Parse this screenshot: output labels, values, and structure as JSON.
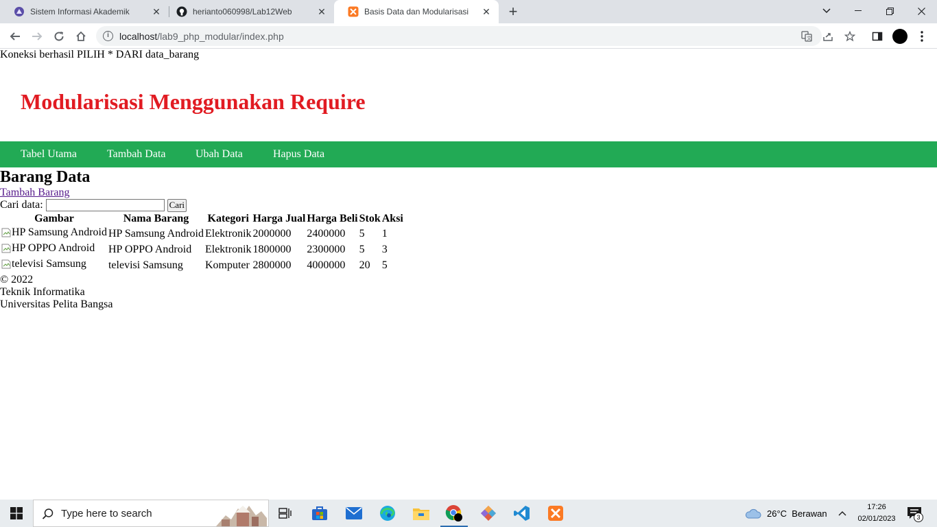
{
  "browser": {
    "tabs": [
      {
        "title": "Sistem Informasi Akademik",
        "icon": "university-icon",
        "active": false
      },
      {
        "title": "herianto060998/Lab12Web",
        "icon": "github-icon",
        "active": false
      },
      {
        "title": "Basis Data dan Modularisasi",
        "icon": "xampp-icon",
        "active": true
      }
    ],
    "url_host": "localhost",
    "url_path": "/lab9_php_modular/index.php"
  },
  "page": {
    "connection_message": "Koneksi berhasil PILIH * DARI data_barang",
    "site_title": "Modularisasi Menggunakan Require",
    "nav": [
      "Tabel Utama",
      "Tambah Data",
      "Ubah Data",
      "Hapus Data"
    ],
    "heading": "Barang Data",
    "add_link": "Tambah Barang",
    "search_label": "Cari data:",
    "search_value": "",
    "search_button": "Cari",
    "table": {
      "headers": [
        "Gambar",
        "Nama Barang",
        "Kategori",
        "Harga Jual",
        "Harga Beli",
        "Stok",
        "Aksi"
      ],
      "rows": [
        [
          "HP Samsung Android",
          "HP Samsung Android",
          "Elektronik",
          "2000000",
          "2400000",
          "5",
          "1"
        ],
        [
          "HP OPPO Android",
          "HP OPPO Android",
          "Elektronik",
          "1800000",
          "2300000",
          "5",
          "3"
        ],
        [
          "televisi Samsung",
          "televisi Samsung",
          "Komputer",
          "2800000",
          "4000000",
          "20",
          "5"
        ]
      ]
    },
    "footer": {
      "copyright": "© 2022",
      "line1": "Teknik Informatika",
      "line2": "Universitas Pelita Bangsa"
    }
  },
  "taskbar": {
    "search_placeholder": "Type here to search",
    "weather": "26°C  Berawan",
    "time": "17:26",
    "date": "02/01/2023",
    "notification_count": "3"
  },
  "colors": {
    "title_red": "#e11b22",
    "nav_green": "#22aa55",
    "link_purple": "#551a8b"
  }
}
